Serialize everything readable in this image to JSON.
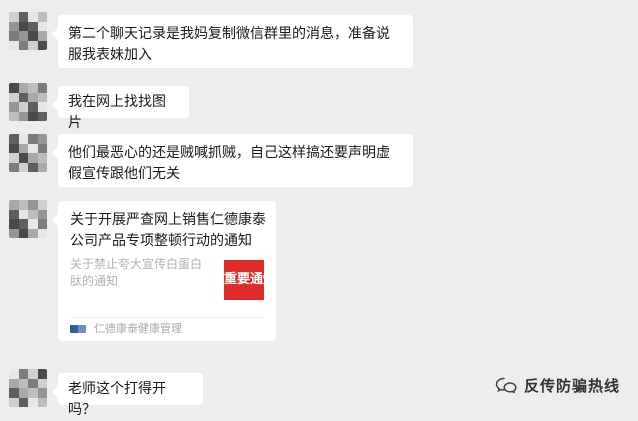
{
  "messages": [
    {
      "text": "第二个聊天记录是我妈复制微信群里的消息，准备说服我表妹加入"
    },
    {
      "text": "我在网上找找图片"
    },
    {
      "text": "他们最恶心的还是贼喊抓贼，自己这样搞还要声明虚假宣传跟他们无关"
    },
    {
      "text": "老师这个打得开吗？"
    }
  ],
  "link_card": {
    "title": "关于开展严查网上销售仁德康泰公司产品专项整顿行动的通知",
    "description": "关于禁止夸大宣传白蛋白肽的通知",
    "thumbnail_text": "重要通知",
    "source": "仁德康泰健康管理"
  },
  "watermark": {
    "icon": "wechat-official-account-icon",
    "text": "反传防骗热线"
  },
  "colors": {
    "background": "#ededed",
    "bubble": "#ffffff",
    "thumbnail_red": "#e02b2b",
    "muted_text": "#b2b2b2"
  }
}
